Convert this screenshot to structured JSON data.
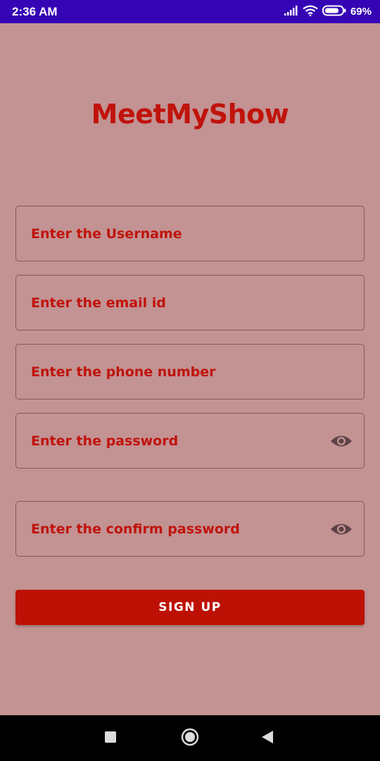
{
  "status_bar": {
    "time": "2:36 AM",
    "battery": "69%",
    "icons": [
      "signal-icon",
      "wifi-icon",
      "battery-icon"
    ]
  },
  "app": {
    "title": "MeetMyShow"
  },
  "form": {
    "username_placeholder": "Enter the Username",
    "email_placeholder": "Enter the email id",
    "phone_placeholder": "Enter the phone number",
    "password_placeholder": "Enter the password",
    "confirm_password_placeholder": "Enter the confirm password"
  },
  "signup": {
    "label": "SIGN UP"
  },
  "nav_bar": {
    "icons": [
      "recents-square-icon",
      "home-circle-icon",
      "back-triangle-icon"
    ]
  },
  "colors": {
    "status_bar": "#3504b4",
    "background": "#c39293",
    "accent": "#c0130b",
    "button": "#bd1105",
    "field_border": "#7d5c5e"
  }
}
